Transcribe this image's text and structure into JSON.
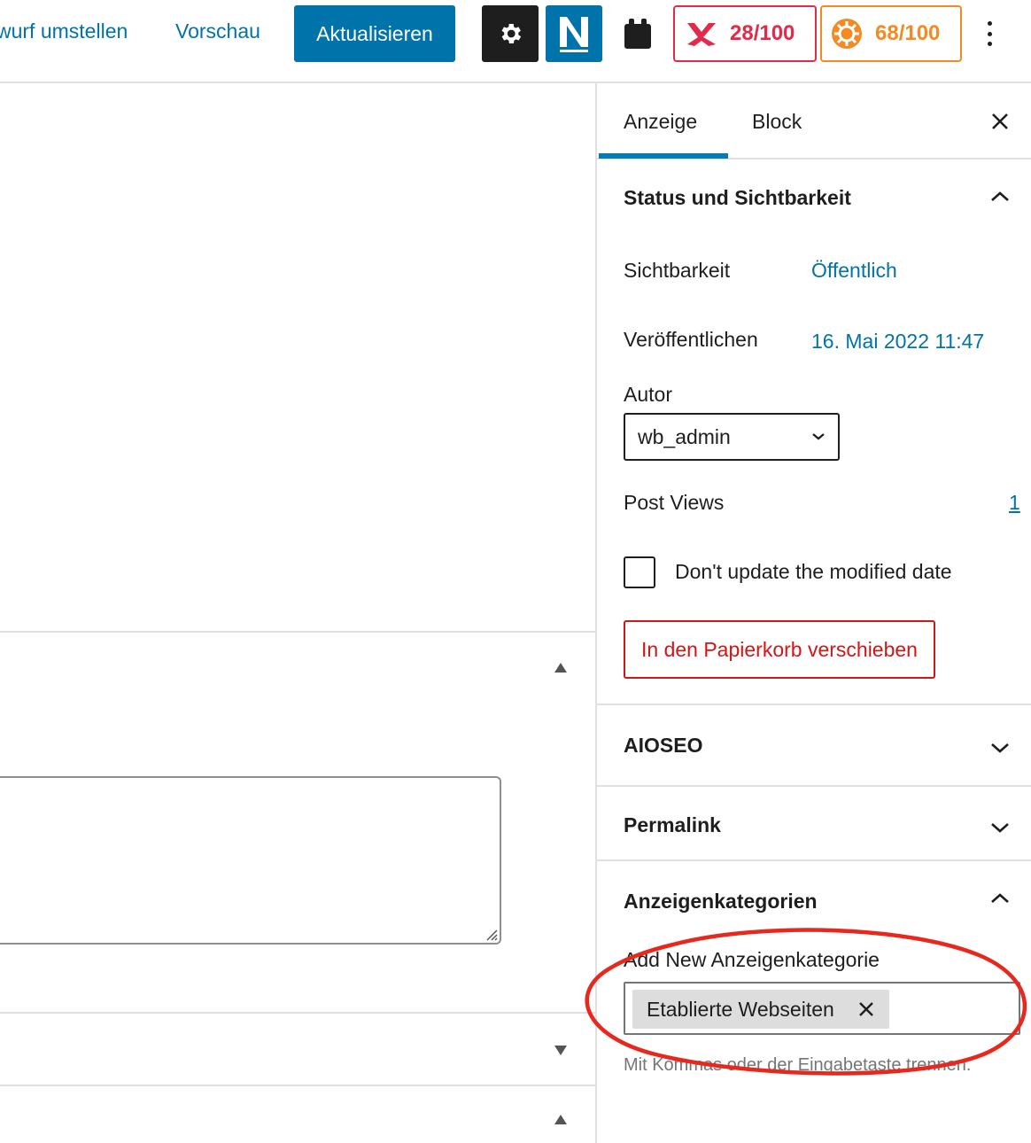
{
  "toolbar": {
    "switch_draft_label": "wurf umstellen",
    "preview_label": "Vorschau",
    "update_label": "Aktualisieren",
    "seo_score": "28/100",
    "readability_score": "68/100",
    "seo_score_color": "#e22b4b",
    "readability_score_color": "#f38a24",
    "settings_icon": "gear-icon",
    "plugin_icon": "N",
    "plugin_color": "#0073aa"
  },
  "sidebar": {
    "tabs": [
      {
        "label": "Anzeige",
        "active": true
      },
      {
        "label": "Block",
        "active": false
      }
    ],
    "status_panel": {
      "title": "Status und Sichtbarkeit",
      "visibility_label": "Sichtbarkeit",
      "visibility_value": "Öffentlich",
      "publish_label": "Veröffentlichen",
      "publish_value": "16. Mai 2022 11:47",
      "author_label": "Autor",
      "author_value": "wb_admin",
      "post_views_label": "Post Views",
      "post_views_value": "1",
      "modified_checkbox_label": "Don't update the modified date",
      "modified_checkbox_checked": false,
      "trash_label": "In den Papierkorb verschieben"
    },
    "aioseo_panel": {
      "title": "AIOSEO"
    },
    "permalink_panel": {
      "title": "Permalink"
    },
    "categories_panel": {
      "title": "Anzeigenkategorien",
      "add_new_label": "Add New Anzeigenkategorie",
      "tokens": [
        "Etablierte Webseiten"
      ],
      "help_text": "Mit Kommas oder der Eingabetaste trennen."
    }
  },
  "annotation_color": "#e8281e"
}
